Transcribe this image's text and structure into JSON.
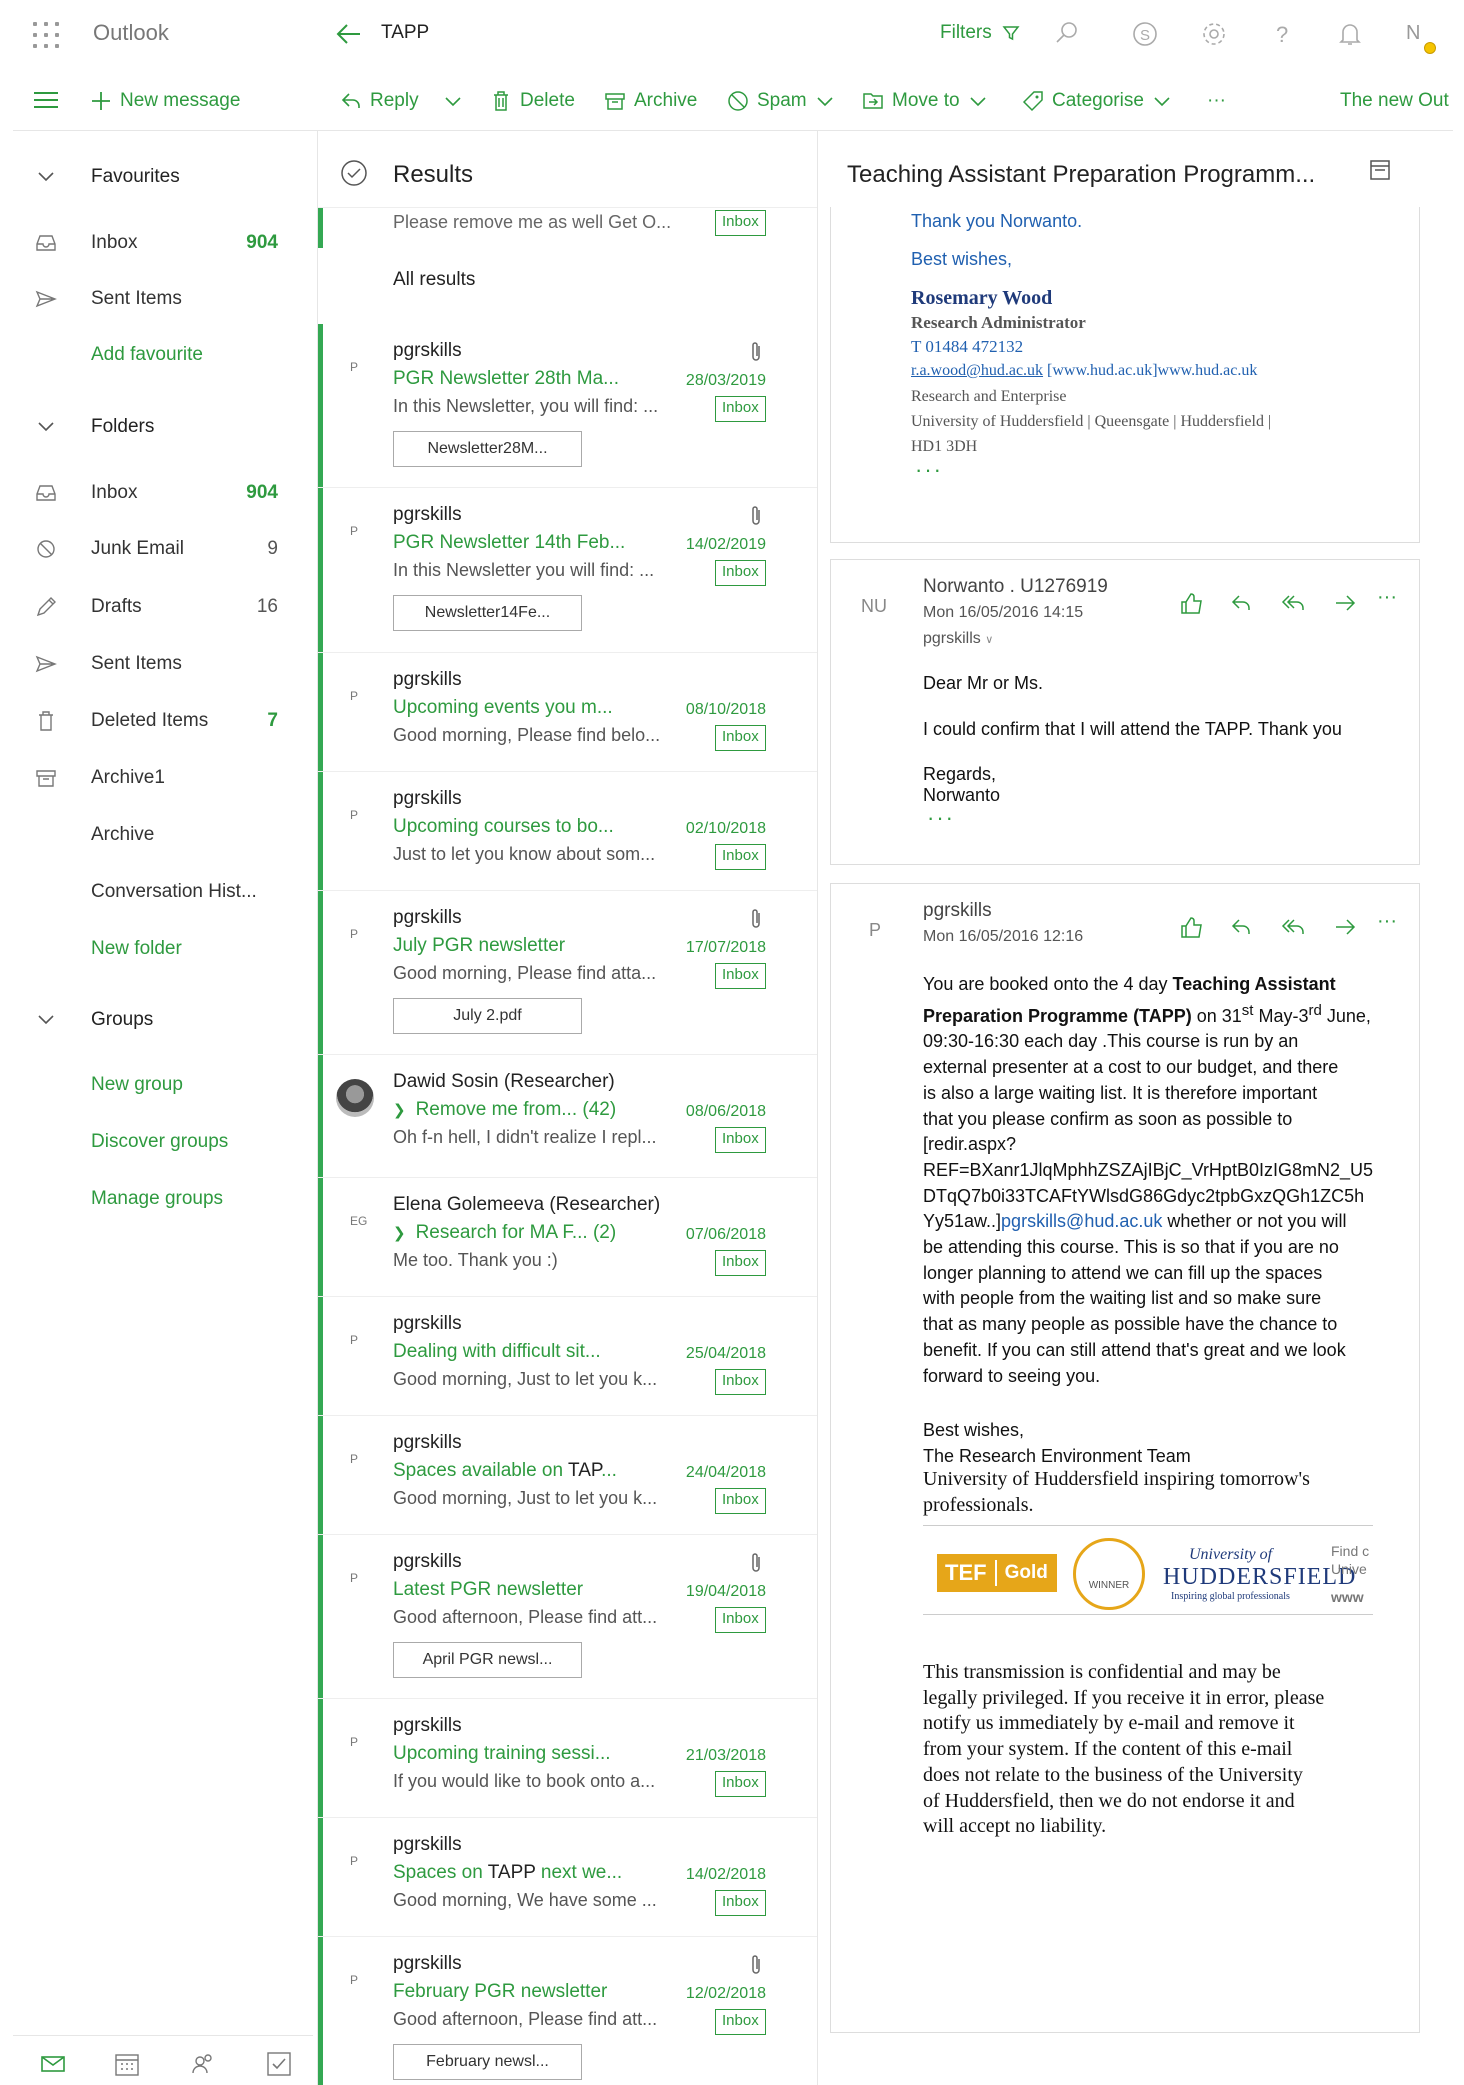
{
  "app": {
    "name": "Outlook",
    "folder_title": "TAPP",
    "filters_label": "Filters",
    "user_initial": "N"
  },
  "toolbar": {
    "new_message": "New message",
    "reply": "Reply",
    "delete": "Delete",
    "archive": "Archive",
    "spam": "Spam",
    "move_to": "Move to",
    "categorise": "Categorise",
    "more": "···",
    "new_outlook": "The new Out"
  },
  "sidebar": {
    "favourites": "Favourites",
    "fav_inbox": "Inbox",
    "fav_inbox_count": "904",
    "fav_sent": "Sent Items",
    "add_favourite": "Add favourite",
    "folders": "Folders",
    "inbox": "Inbox",
    "inbox_count": "904",
    "junk": "Junk Email",
    "junk_count": "9",
    "drafts": "Drafts",
    "drafts_count": "16",
    "sent": "Sent Items",
    "deleted": "Deleted Items",
    "deleted_count": "7",
    "archive1": "Archive1",
    "archive": "Archive",
    "conversation": "Conversation Hist...",
    "new_folder": "New folder",
    "groups": "Groups",
    "new_group": "New group",
    "discover_groups": "Discover groups",
    "manage_groups": "Manage groups"
  },
  "list": {
    "title": "Results",
    "top_preview": "Please remove me as well Get O...",
    "top_badge": "Inbox",
    "all_results": "All results",
    "messages": [
      {
        "init": "P",
        "sender": "pgrskills",
        "subject": "PGR Newsletter 28th Ma...",
        "date": "28/03/2019",
        "preview": "In this Newsletter, you will find: ...",
        "badge": "Inbox",
        "attachment": "Newsletter28M...",
        "clip": true
      },
      {
        "init": "P",
        "sender": "pgrskills",
        "subject": "PGR Newsletter 14th Feb...",
        "date": "14/02/2019",
        "preview": "In this Newsletter you will find: ...",
        "badge": "Inbox",
        "attachment": "Newsletter14Fe...",
        "clip": true
      },
      {
        "init": "P",
        "sender": "pgrskills",
        "subject": "Upcoming events you m...",
        "date": "08/10/2018",
        "preview": "Good morning, Please find belo...",
        "badge": "Inbox"
      },
      {
        "init": "P",
        "sender": "pgrskills",
        "subject": "Upcoming courses to bo...",
        "date": "02/10/2018",
        "preview": "Just to let you know about som...",
        "badge": "Inbox"
      },
      {
        "init": "P",
        "sender": "pgrskills",
        "subject": "July PGR newsletter",
        "date": "17/07/2018",
        "preview": "Good morning, Please find atta...",
        "badge": "Inbox",
        "attachment": "July 2.pdf",
        "clip": true
      },
      {
        "init": "",
        "sender": "Dawid Sosin (Researcher)",
        "subject": "Remove me from...  (42)",
        "date": "08/06/2018",
        "preview": "Oh f-n hell, I didn't realize I repl...",
        "badge": "Inbox",
        "thread": true,
        "avatar": true
      },
      {
        "init": "EG",
        "sender": "Elena Golemeeva (Researcher)",
        "subject": "Research for MA F...  (2)",
        "date": "07/06/2018",
        "preview": "Me too. Thank you :)",
        "badge": "Inbox",
        "thread": true
      },
      {
        "init": "P",
        "sender": "pgrskills",
        "subject": "Dealing with difficult sit...",
        "date": "25/04/2018",
        "preview": "Good morning, Just to let you k...",
        "badge": "Inbox"
      },
      {
        "init": "P",
        "sender": "pgrskills",
        "subject_pre": "Spaces available on ",
        "subject_hl": "TAP",
        "subject_post": "...",
        "date": "24/04/2018",
        "preview": "Good morning, Just to let you k...",
        "badge": "Inbox"
      },
      {
        "init": "P",
        "sender": "pgrskills",
        "subject": "Latest PGR newsletter",
        "date": "19/04/2018",
        "preview": "Good afternoon, Please find att...",
        "badge": "Inbox",
        "attachment": "April PGR newsl...",
        "clip": true
      },
      {
        "init": "P",
        "sender": "pgrskills",
        "subject": "Upcoming training sessi...",
        "date": "21/03/2018",
        "preview": "If you would like to book onto a...",
        "badge": "Inbox"
      },
      {
        "init": "P",
        "sender": "pgrskills",
        "subject_pre": "Spaces on ",
        "subject_hl": "TAPP",
        "subject_post": " next we...",
        "date": "14/02/2018",
        "preview": "Good morning, We have some ...",
        "badge": "Inbox"
      },
      {
        "init": "P",
        "sender": "pgrskills",
        "subject": "February PGR newsletter",
        "date": "12/02/2018",
        "preview": "Good afternoon, Please find att...",
        "badge": "Inbox",
        "attachment": "February newsl...",
        "clip": true
      }
    ]
  },
  "reader": {
    "title": "Teaching Assistant Preparation Programm...",
    "msg1": {
      "thanks": "Thank you Norwanto.",
      "best": "Best wishes,",
      "sig_name": "Rosemary Wood",
      "sig_role": "Research Administrator",
      "sig_phone": "T 01484 472132",
      "sig_email": "r.a.wood@hud.ac.uk",
      "sig_web1": " [www.hud.ac.uk]",
      "sig_web2": "www.hud.ac.uk",
      "sig_dept": "Research and Enterprise",
      "sig_addr1": "University of Huddersfield | Queensgate | Huddersfield |",
      "sig_addr2": "HD1 3DH",
      "more": "···"
    },
    "msg2": {
      "init": "NU",
      "from": "Norwanto . U1276919",
      "date": "Mon 16/05/2016 14:15",
      "to": "pgrskills",
      "l1": "Dear Mr or Ms.",
      "l2": "I could confirm that I will attend the TAPP. Thank you",
      "l3": "Regards,",
      "l4": "Norwanto",
      "more": "···"
    },
    "msg3": {
      "init": "P",
      "from": "pgrskills",
      "date": "Mon 16/05/2016 12:16",
      "b1": "You are booked onto the 4 day ",
      "b1_bold": "Teaching Assistant",
      "b2_bold": "Preparation Programme (TAPP)",
      "b2": " on 31",
      "b2_sup1": "st",
      "b2b": " May-3",
      "b2_sup2": "rd",
      "b2c": " June,",
      "b3": "09:30-16:30 each day .This course is run by an",
      "b4": "external presenter at a cost to our budget, and there",
      "b5": "is also a large waiting list. It is therefore important",
      "b6": "that you please confirm as soon as possible to",
      "b7": "[redir.aspx?",
      "b8": "REF=BXanr1JlqMphhZSZAjIBjC_VrHptB0IzIG8mN2_U5",
      "b9": "DTqQ7b0i33TCAFtYWlsdG86Gdyc2tpbGxzQGh1ZC5h",
      "b10": "Yy51aw..]",
      "b10_link": "pgrskills@hud.ac.uk",
      "b10_post": " whether or not you will",
      "b11": "be attending this course. This is so that if you are no",
      "b12": "longer planning to attend we can fill up the spaces",
      "b13": "with people from the waiting list and so make sure",
      "b14": "that as many people as possible have the chance to",
      "b15": "benefit. If you can still attend that's great and we look",
      "b16": "forward to seeing you.",
      "best": "Best wishes,",
      "team": "The Research Environment Team",
      "uni1": "University of Huddersfield inspiring tomorrow's",
      "uni2": "professionals.",
      "tef": "TEF",
      "gold": "Gold",
      "winner": "WINNER",
      "uni_of": "University of",
      "uni_name": "HUDDERSFIELD",
      "uni_tag": "Inspiring global professionals",
      "find1": "Find c",
      "find2": "Unive",
      "find3": "www",
      "d1": "This transmission is confidential and may be",
      "d2": "legally privileged. If you receive it in error, please",
      "d3": "notify us immediately by e-mail and remove it",
      "d4": "from your system. If the content of this e-mail",
      "d5": "does not relate to the business of the University",
      "d6": "of Huddersfield, then we do not endorse it and",
      "d7": "will accept no liability."
    }
  },
  "colors": {
    "accent": "#2e9a3f",
    "bar": "#34a853",
    "link": "#2060b0"
  }
}
